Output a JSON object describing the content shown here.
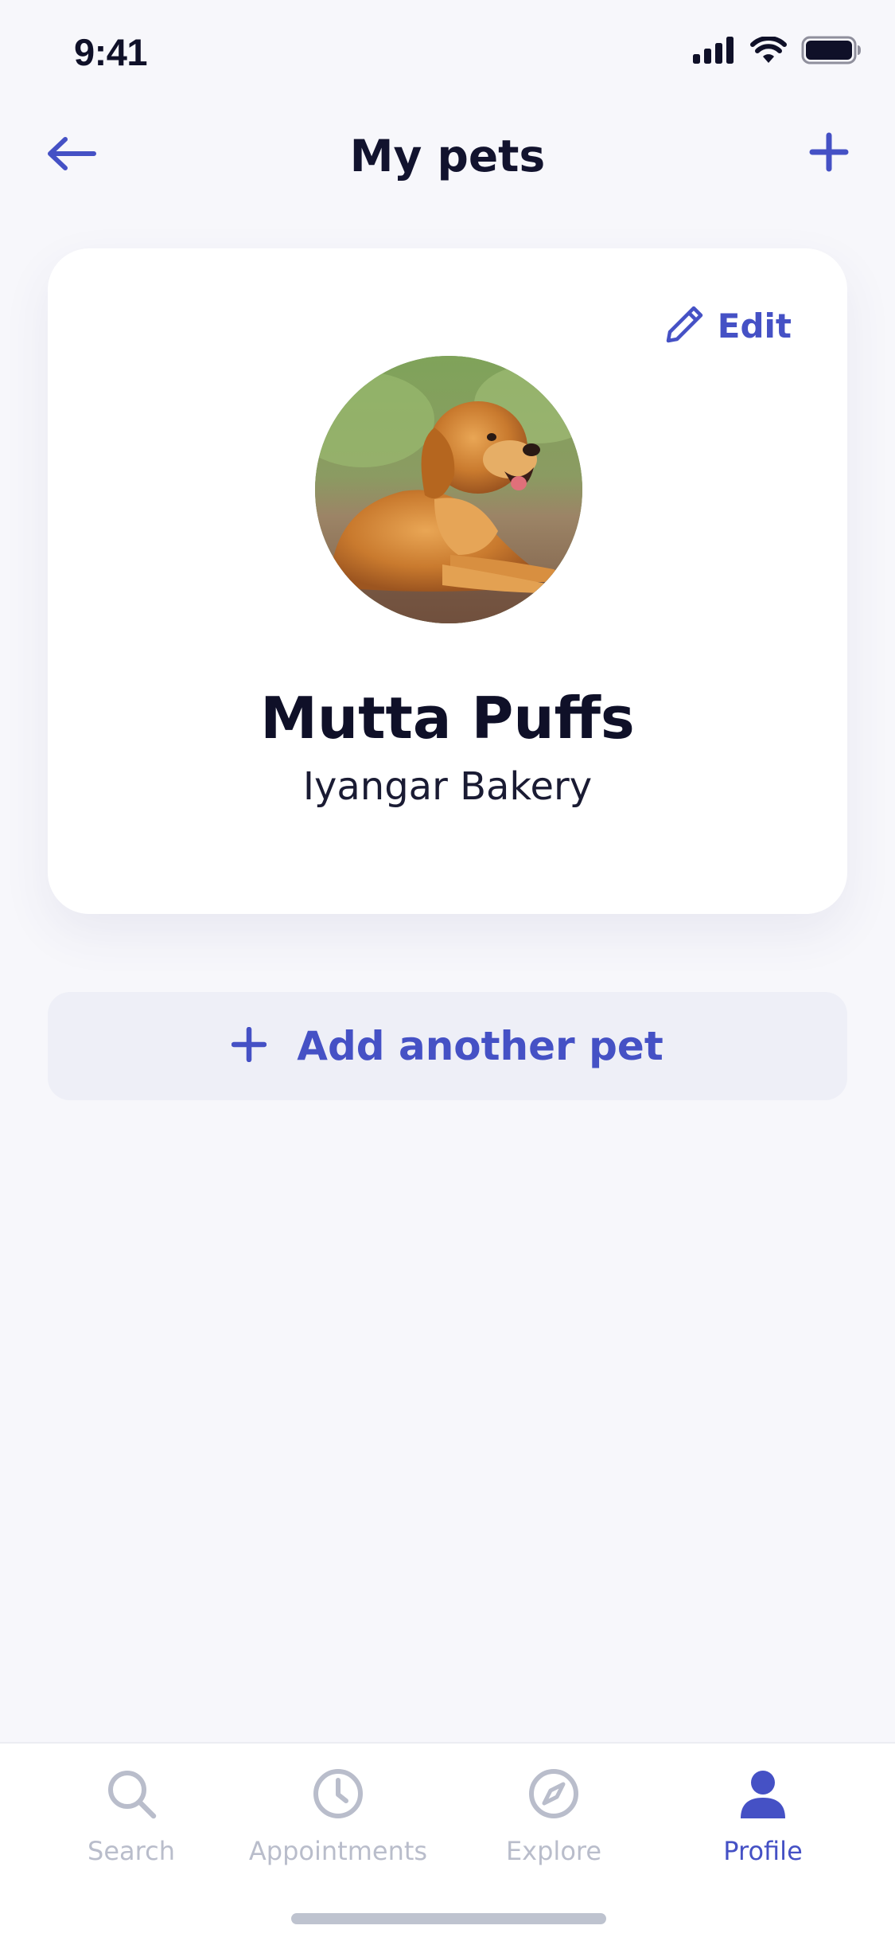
{
  "status_bar": {
    "time": "9:41"
  },
  "header": {
    "title": "My pets",
    "back_icon": "arrow-left-icon",
    "add_icon": "plus-icon"
  },
  "pet_card": {
    "edit_label": "Edit",
    "edit_icon": "pencil-icon",
    "name": "Mutta Puffs",
    "subtitle": "Iyangar Bakery",
    "avatar": "golden-retriever-photo"
  },
  "add_pet": {
    "label": "Add another pet",
    "icon": "plus-icon"
  },
  "tab_bar": {
    "tabs": [
      {
        "label": "Search",
        "icon": "search-icon",
        "active": false
      },
      {
        "label": "Appointments",
        "icon": "clock-icon",
        "active": false
      },
      {
        "label": "Explore",
        "icon": "compass-icon",
        "active": false
      },
      {
        "label": "Profile",
        "icon": "person-icon",
        "active": true
      }
    ]
  },
  "colors": {
    "accent": "#4551C5",
    "background": "#F7F7FB",
    "card": "#FFFFFF",
    "inactive_tab": "#B9BDCB",
    "button_bg": "#EEEFF7"
  }
}
